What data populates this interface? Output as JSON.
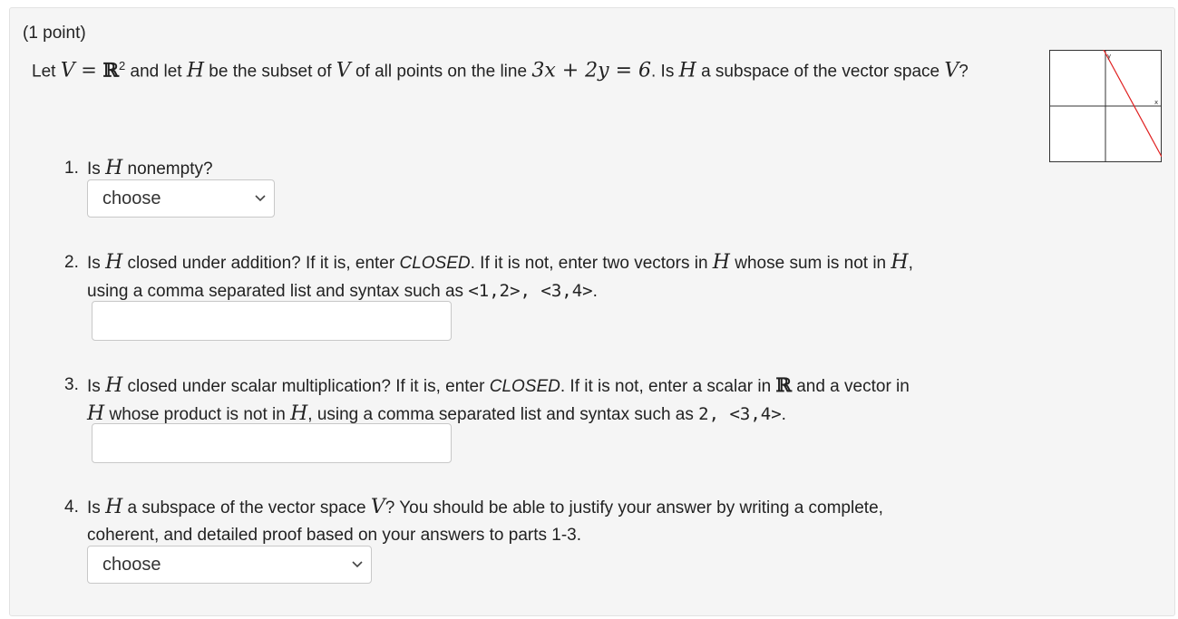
{
  "problem": {
    "points": "(1 point)",
    "statement": {
      "t1": "Let ",
      "V": "V",
      "eq": " = ",
      "R": "ℝ",
      "exp": "2",
      "t2": " and let ",
      "H": "H",
      "t3": " be the subset of ",
      "t4": " of all points on the line ",
      "line": "3x + 2y = 6",
      "t5": ". Is ",
      "t6": " a subspace of the vector space ",
      "t7": "?"
    },
    "graph": {
      "x_label": "x",
      "y_label": "y",
      "line_color": "#e02020"
    }
  },
  "questions": [
    {
      "num": "1.",
      "text_a": "Is ",
      "H": "H",
      "text_b": " nonempty?",
      "select": {
        "value": "choose"
      }
    },
    {
      "num": "2.",
      "text_a": "Is ",
      "H": "H",
      "text_b": " closed under addition? If it is, enter ",
      "closed": "CLOSED",
      "text_c": ". If it is not, enter two vectors in ",
      "text_d": " whose sum is not in ",
      "text_e": ",",
      "text_f": "using a comma separated list and syntax such as ",
      "example": "<1,2>, <3,4>",
      "text_g": ".",
      "input": {
        "value": ""
      }
    },
    {
      "num": "3.",
      "text_a": "Is ",
      "H": "H",
      "text_b": " closed under scalar multiplication? If it is, enter ",
      "closed": "CLOSED",
      "text_c": ". If it is not, enter a scalar in ",
      "R": "ℝ",
      "text_d": " and a vector in",
      "text_e": " whose product is not in ",
      "text_f": ", using a comma separated list and syntax such as ",
      "example": "2, <3,4>",
      "text_g": ".",
      "input": {
        "value": ""
      }
    },
    {
      "num": "4.",
      "text_a": "Is ",
      "H": "H",
      "text_b": " a subspace of the vector space ",
      "V": "V",
      "text_c": "? You should be able to justify your answer by writing a complete,",
      "text_d": "coherent, and detailed proof based on your answers to parts 1-3.",
      "select": {
        "value": "choose"
      }
    }
  ]
}
